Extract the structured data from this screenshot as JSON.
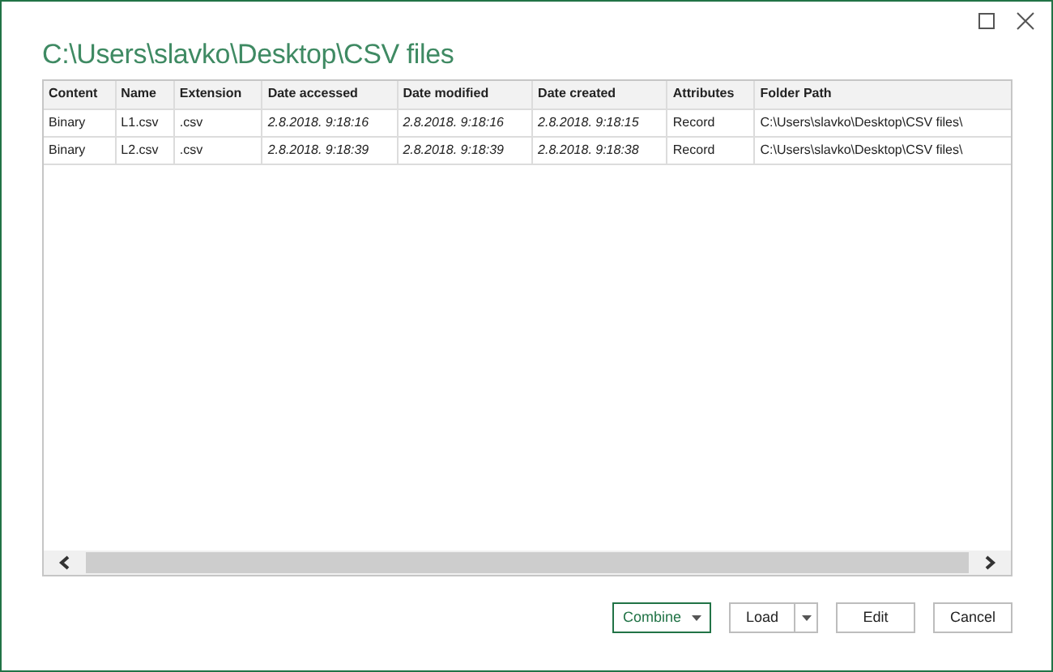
{
  "title": "C:\\Users\\slavko\\Desktop\\CSV files",
  "table": {
    "columns": [
      {
        "label": "Content",
        "kind": "text"
      },
      {
        "label": "Name",
        "kind": "text"
      },
      {
        "label": "Extension",
        "kind": "text"
      },
      {
        "label": "Date accessed",
        "kind": "date"
      },
      {
        "label": "Date modified",
        "kind": "date"
      },
      {
        "label": "Date created",
        "kind": "date"
      },
      {
        "label": "Attributes",
        "kind": "text"
      },
      {
        "label": "Folder Path",
        "kind": "text"
      }
    ],
    "rows": [
      [
        "Binary",
        "L1.csv",
        ".csv",
        "2.8.2018. 9:18:16",
        "2.8.2018. 9:18:16",
        "2.8.2018. 9:18:15",
        "Record",
        "C:\\Users\\slavko\\Desktop\\CSV files\\"
      ],
      [
        "Binary",
        "L2.csv",
        ".csv",
        "2.8.2018. 9:18:39",
        "2.8.2018. 9:18:39",
        "2.8.2018. 9:18:38",
        "Record",
        "C:\\Users\\slavko\\Desktop\\CSV files\\"
      ]
    ]
  },
  "buttons": [
    {
      "label": "Combine",
      "kind": "menu",
      "primary": true
    },
    {
      "label": "Load",
      "kind": "split",
      "primary": false
    },
    {
      "label": "Edit",
      "kind": "plain",
      "primary": false
    },
    {
      "label": "Cancel",
      "kind": "plain",
      "primary": false
    }
  ]
}
